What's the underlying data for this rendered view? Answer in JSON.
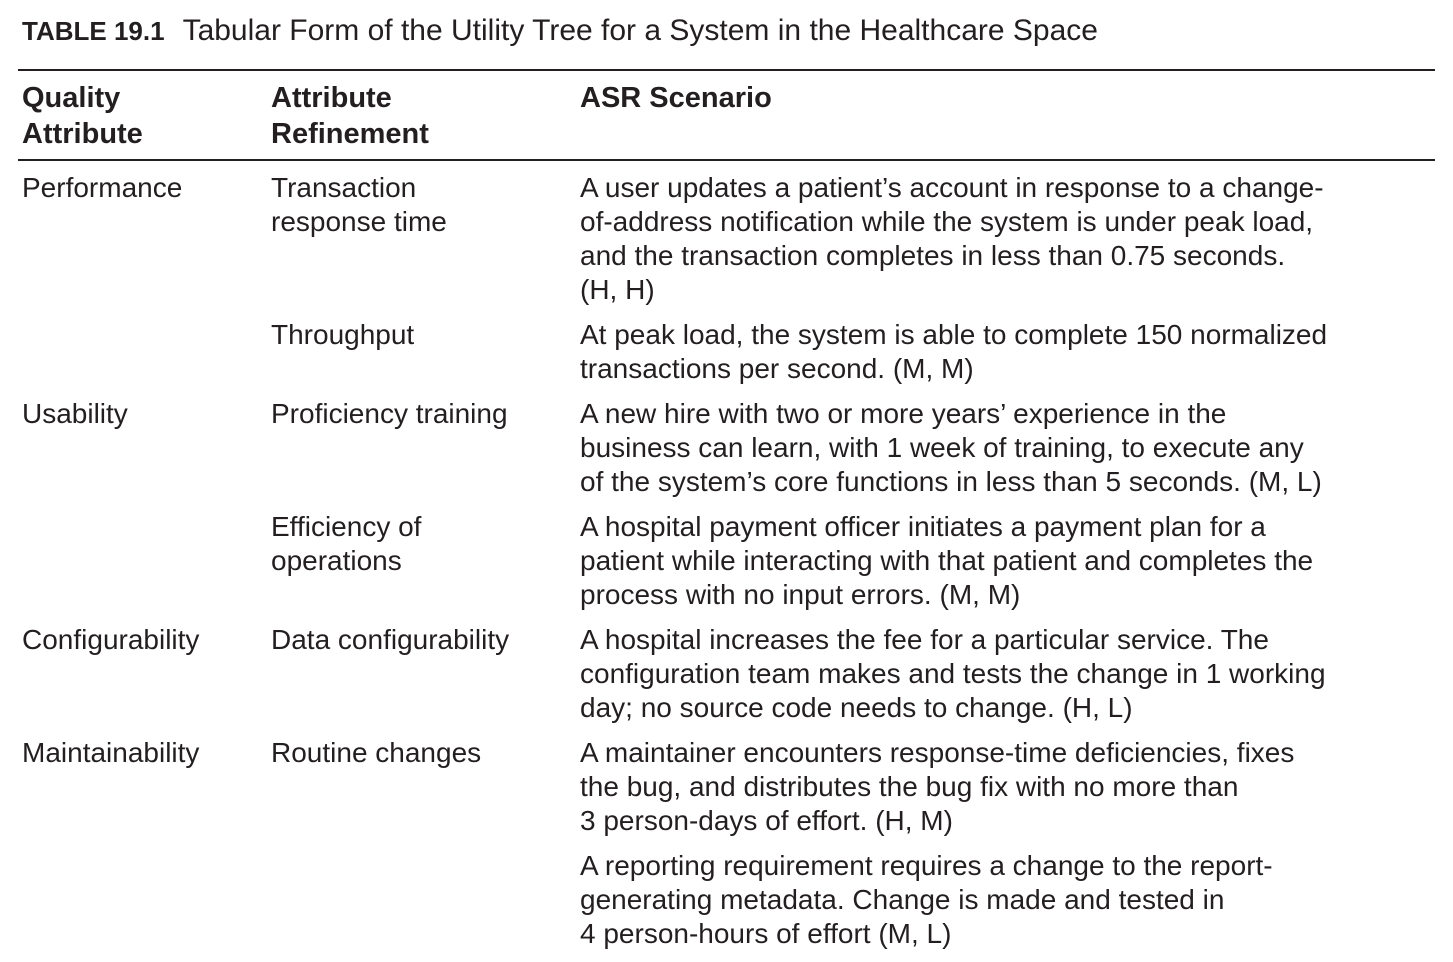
{
  "caption": {
    "number": "TABLE 19.1",
    "title": "Tabular Form of the Utility Tree for a System in the Healthcare Space"
  },
  "headers": [
    "Quality\nAttribute",
    "Attribute\nRefinement",
    "ASR Scenario"
  ],
  "rows": [
    {
      "attribute": "Performance",
      "refinement": "Transaction\nresponse time",
      "scenario": "A user updates a patient’s account in response to a change-\nof-address notification while the system is under peak load,\nand the transaction completes in less than 0.75 seconds.\n(H, H)"
    },
    {
      "attribute": "",
      "refinement": "Throughput",
      "scenario": "At peak load, the system is able to complete 150 normalized\ntransactions per second. (M, M)"
    },
    {
      "attribute": "Usability",
      "refinement": "Proficiency training",
      "scenario": "A new hire with two or more years’ experience in the\nbusiness can learn, with 1 week of training, to execute any\nof the system’s core functions in less than 5 seconds. (M, L)"
    },
    {
      "attribute": "",
      "refinement": "Efficiency of\noperations",
      "scenario": "A hospital payment officer initiates a payment plan for a\npatient while interacting with that patient and completes the\nprocess with no input errors. (M, M)"
    },
    {
      "attribute": "Configurability",
      "refinement": "Data configurability",
      "scenario": "A hospital increases the fee for a particular service. The\nconfiguration team makes and tests the change in 1 working\nday; no source code needs to change. (H, L)"
    },
    {
      "attribute": "Maintainability",
      "refinement": "Routine changes",
      "scenario": "A maintainer encounters response-time deficiencies, fixes\nthe bug, and distributes the bug fix with no more than\n3 person-days of effort. (H, M)"
    },
    {
      "attribute": "",
      "refinement": "",
      "scenario": "A reporting requirement requires a change to the report-\ngenerating metadata. Change is made and tested in\n4 person-hours of effort (M, L)"
    }
  ]
}
